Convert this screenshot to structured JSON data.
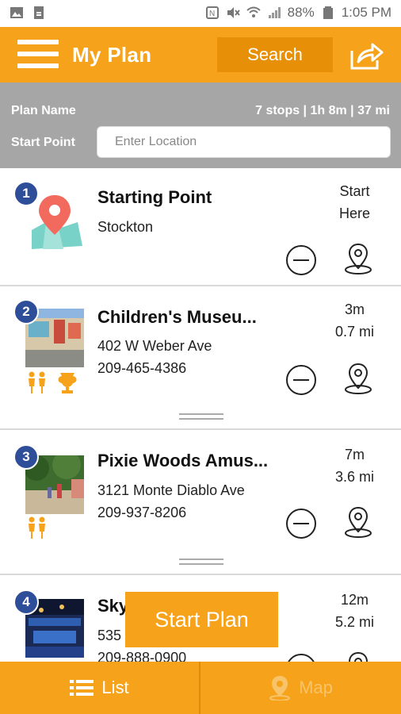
{
  "status_bar": {
    "battery": "88%",
    "time": "1:05 PM"
  },
  "header": {
    "title": "My Plan",
    "search_label": "Search"
  },
  "plan": {
    "name_label": "Plan Name",
    "summary": "7 stops | 1h 8m | 37 mi",
    "start_point_label": "Start Point",
    "location_placeholder": "Enter Location"
  },
  "stops": [
    {
      "number": "1",
      "name": "Starting Point",
      "line1": "Stockton",
      "line2": "",
      "metric1": "Start",
      "metric2": "Here",
      "icon": "map-location-icon"
    },
    {
      "number": "2",
      "name": "Children's Museu...",
      "line1": "402 W Weber Ave",
      "line2": "209-465-4386",
      "metric1": "3m",
      "metric2": "0.7 mi",
      "tags": [
        "family-icon",
        "trophy-vase-icon"
      ]
    },
    {
      "number": "3",
      "name": "Pixie Woods Amus...",
      "line1": "3121 Monte Diablo Ave",
      "line2": "209-937-8206",
      "metric1": "7m",
      "metric2": "3.6 mi",
      "tags": [
        "family-icon"
      ]
    },
    {
      "number": "4",
      "name": "Sky",
      "line1": "535",
      "line2": "209-888-0900",
      "metric1": "12m",
      "metric2": "5.2 mi"
    }
  ],
  "start_plan_label": "Start Plan",
  "bottom_nav": {
    "list_label": "List",
    "map_label": "Map"
  },
  "colors": {
    "accent": "#F6A21B",
    "accent_dark": "#E88F08",
    "plan_bar": "#A6A6A6",
    "badge": "#2E4E99"
  }
}
